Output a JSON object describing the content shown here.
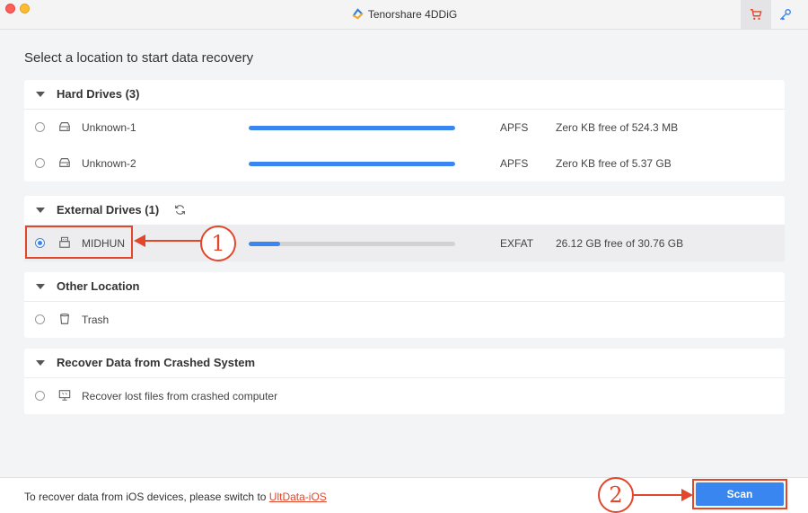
{
  "window": {
    "title": "Tenorshare 4DDiG"
  },
  "page": {
    "heading": "Select a location to start data recovery"
  },
  "sections": {
    "hard_drives": {
      "title": "Hard Drives (3)",
      "items": [
        {
          "label": "Unknown-1",
          "fs": "APFS",
          "free": "Zero KB free of 524.3 MB",
          "used_fraction": 1.0
        },
        {
          "label": "Unknown-2",
          "fs": "APFS",
          "free": "Zero KB free of 5.37 GB",
          "used_fraction": 1.0
        }
      ]
    },
    "external_drives": {
      "title": "External Drives (1)",
      "items": [
        {
          "label": "MIDHUN",
          "fs": "EXFAT",
          "free": "26.12 GB free of 30.76 GB",
          "used_fraction": 0.15,
          "selected": true
        }
      ]
    },
    "other_location": {
      "title": "Other Location",
      "items": [
        {
          "label": "Trash"
        }
      ]
    },
    "crashed_system": {
      "title": "Recover Data from Crashed System",
      "items": [
        {
          "label": "Recover lost files from crashed computer"
        }
      ]
    }
  },
  "annotations": {
    "step1": "1",
    "step2": "2"
  },
  "footer": {
    "text": "To recover data from iOS devices, please switch to ",
    "link": "UltData-iOS",
    "scan_label": "Scan"
  },
  "colors": {
    "accent": "#3a86f0",
    "annotation": "#e2462b"
  }
}
